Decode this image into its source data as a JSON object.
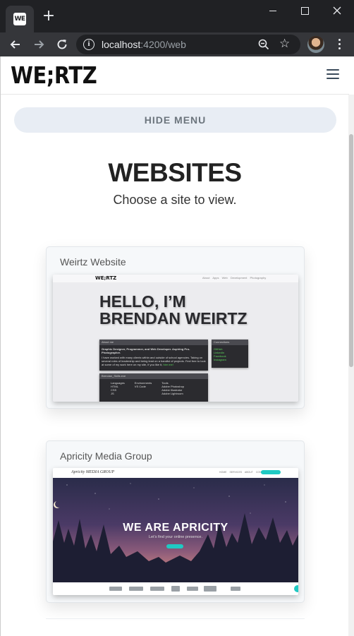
{
  "browser": {
    "tab_favicon": "WE",
    "url_host": "localhost",
    "url_rest": ":4200/web",
    "icons": {
      "new_tab": "plus-icon",
      "back": "arrow-left-icon",
      "forward": "arrow-right-icon",
      "reload": "reload-icon",
      "info": "info-icon",
      "zoom": "zoom-out-icon",
      "bookmark": "star-icon",
      "menu": "kebab-menu-icon"
    }
  },
  "site": {
    "logo": "WE;RTZ",
    "hide_menu_label": "HIDE MENU",
    "title": "WEBSITES",
    "subtitle": "Choose a site to view."
  },
  "cards": [
    {
      "title": "Weirtz Website",
      "thumb": {
        "nav_logo": "WE;RTZ",
        "nav_links": "About  Apps  Web Development  Photography",
        "hero": "HELLO, I’M BRENDAN WEIRTZ",
        "about_bar": "About me",
        "about_lead": "Graphic Designer, Programmer, and Web Developer. Aspiring Pro-Photographer.",
        "about_body": "I have worked with many clients within and outside of school agencies. Taking on several roles of leadership and being lead on a handful of projects. Feel free to look at some of my work here on my site, if you like it,",
        "about_link": "hire me!",
        "connect_bar": "Connections",
        "connect_items": [
          "GitHub",
          "LinkedIn",
          "Facebook",
          "Instagram"
        ],
        "skills_bar": "Brendan_Skills.exe",
        "skills_heads": [
          "Languages",
          "Environments",
          "Tools"
        ],
        "skills_cols": [
          [
            "HTML",
            "CSS",
            "JS"
          ],
          [
            "VS Code"
          ],
          [
            "Adobe Photoshop",
            "Adobe Illustrator",
            "Adobe Lightroom"
          ]
        ]
      }
    },
    {
      "title": "Apricity Media Group",
      "thumb": {
        "nav_logo": "Apricity MEDIA GROUP",
        "nav_links": "HOME  SERVICES  ABOUT  CONTACT",
        "hero": "WE ARE APRICITY",
        "sub": "Let’s find your online presence."
      }
    }
  ],
  "colors": {
    "accent_teal": "#1fc9c3",
    "skill_green": "#5bd35b",
    "button_bg": "#e8edf4",
    "button_text": "#6c757d"
  }
}
